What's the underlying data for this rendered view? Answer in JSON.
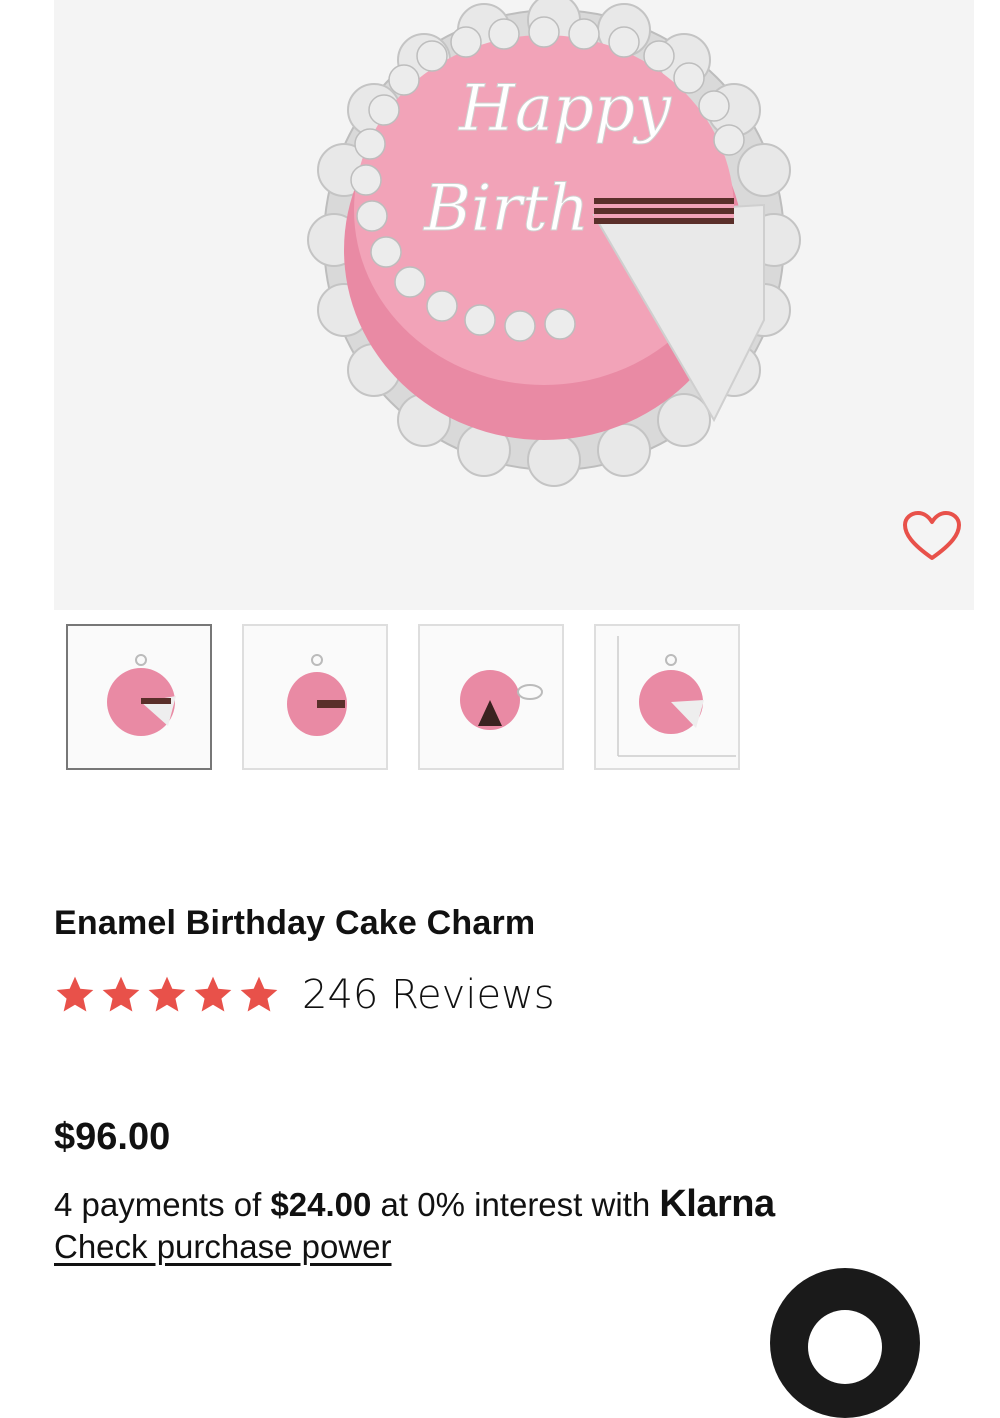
{
  "product": {
    "title": "Enamel Birthday Cake Charm",
    "rating": 5,
    "rating_max": 5,
    "reviews_label": "246 Reviews",
    "price": "$96.00"
  },
  "image": {
    "cake_text_line1": "Happy",
    "cake_text_line2": "Birth"
  },
  "klarna": {
    "prefix": "4 payments of ",
    "amount": "$24.00",
    "suffix": " at 0% interest with ",
    "brand": "Klarna",
    "link": "Check purchase power"
  },
  "thumbnails": [
    {
      "name": "front view",
      "selected": true
    },
    {
      "name": "side view",
      "selected": false
    },
    {
      "name": "angled view",
      "selected": false
    },
    {
      "name": "size view",
      "selected": false
    }
  ],
  "colors": {
    "star": "#e8514a",
    "heart": "#e8514a",
    "cake_pink": "#f2a3b8",
    "hero_bg": "#f4f4f4"
  },
  "icons": [
    "heart-icon",
    "star-icon",
    "chat-icon"
  ]
}
